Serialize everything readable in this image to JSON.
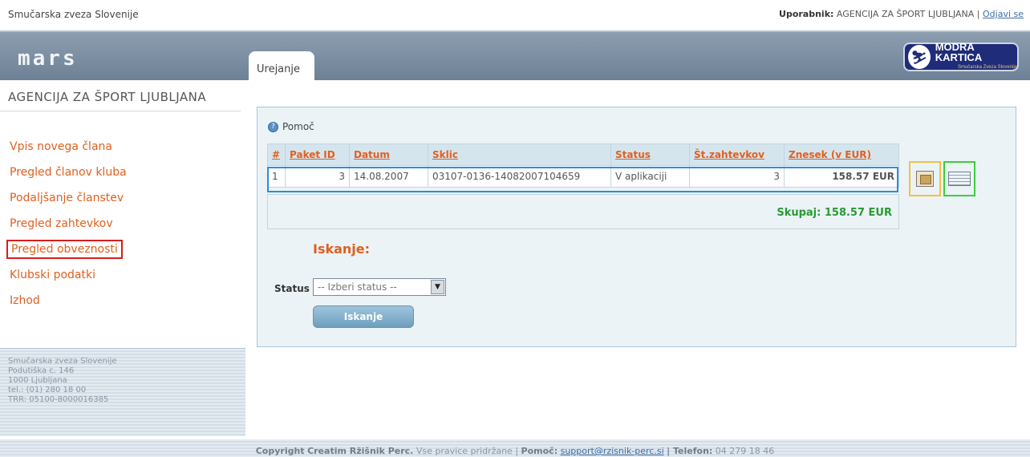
{
  "top": {
    "org": "Smučarska zveza Slovenije",
    "user_label": "Uporabnik:",
    "user_name": "AGENCIJA ZA ŠPORT LJUBLJANA",
    "separator": "|",
    "logout": "Odjavi se"
  },
  "header": {
    "logo": "mars",
    "brand_title": "MODRA KARTICA",
    "brand_sub": "Smučarska Zveza Slovenije"
  },
  "sidebar": {
    "club_name": "AGENCIJA ZA ŠPORT LJUBLJANA",
    "items": [
      {
        "label": "Vpis novega člana"
      },
      {
        "label": "Pregled članov kluba"
      },
      {
        "label": "Podaljšanje članstev"
      },
      {
        "label": "Pregled zahtevkov"
      },
      {
        "label": "Pregled obveznosti"
      },
      {
        "label": "Klubski podatki"
      },
      {
        "label": "Izhod"
      }
    ],
    "footer": [
      "Smučarska zveza Slovenije",
      "Podutiška c. 146",
      "1000 Ljubljana",
      "tel.: (01) 280 18 00",
      "TRR: 05100-8000016385"
    ]
  },
  "tab": {
    "label": "Urejanje"
  },
  "help": {
    "label": "Pomoč"
  },
  "table": {
    "headers": [
      "#",
      "Paket ID",
      "Datum",
      "Sklic",
      "Status",
      "Št.zahtevkov",
      "Znesek (v EUR)"
    ],
    "rows": [
      {
        "n": "1",
        "paket_id": "3",
        "datum": "14.08.2007",
        "sklic": "03107-0136-14082007104659",
        "status": "V aplikaciji",
        "zahtevkov": "3",
        "znesek": "158.57 EUR"
      }
    ],
    "total": "Skupaj: 158.57 EUR"
  },
  "search": {
    "title": "Iskanje:",
    "status_label": "Status",
    "status_value": "-- Izberi status --",
    "button": "Iskanje"
  },
  "footer": {
    "copyright_prefix": "Copyright",
    "company": "Creatim Ržišnik Perc.",
    "rights": "Vse pravice pridržane |",
    "help_label": "Pomoč:",
    "email": "support@rzisnik-perc.si",
    "phone_label": "| Telefon:",
    "phone": "04 279 18 46"
  },
  "colors": {
    "accent": "#e0601f",
    "total_green": "#2a9a34",
    "highlight_red": "#d61e1e",
    "row_blue": "#2a8fd8"
  }
}
